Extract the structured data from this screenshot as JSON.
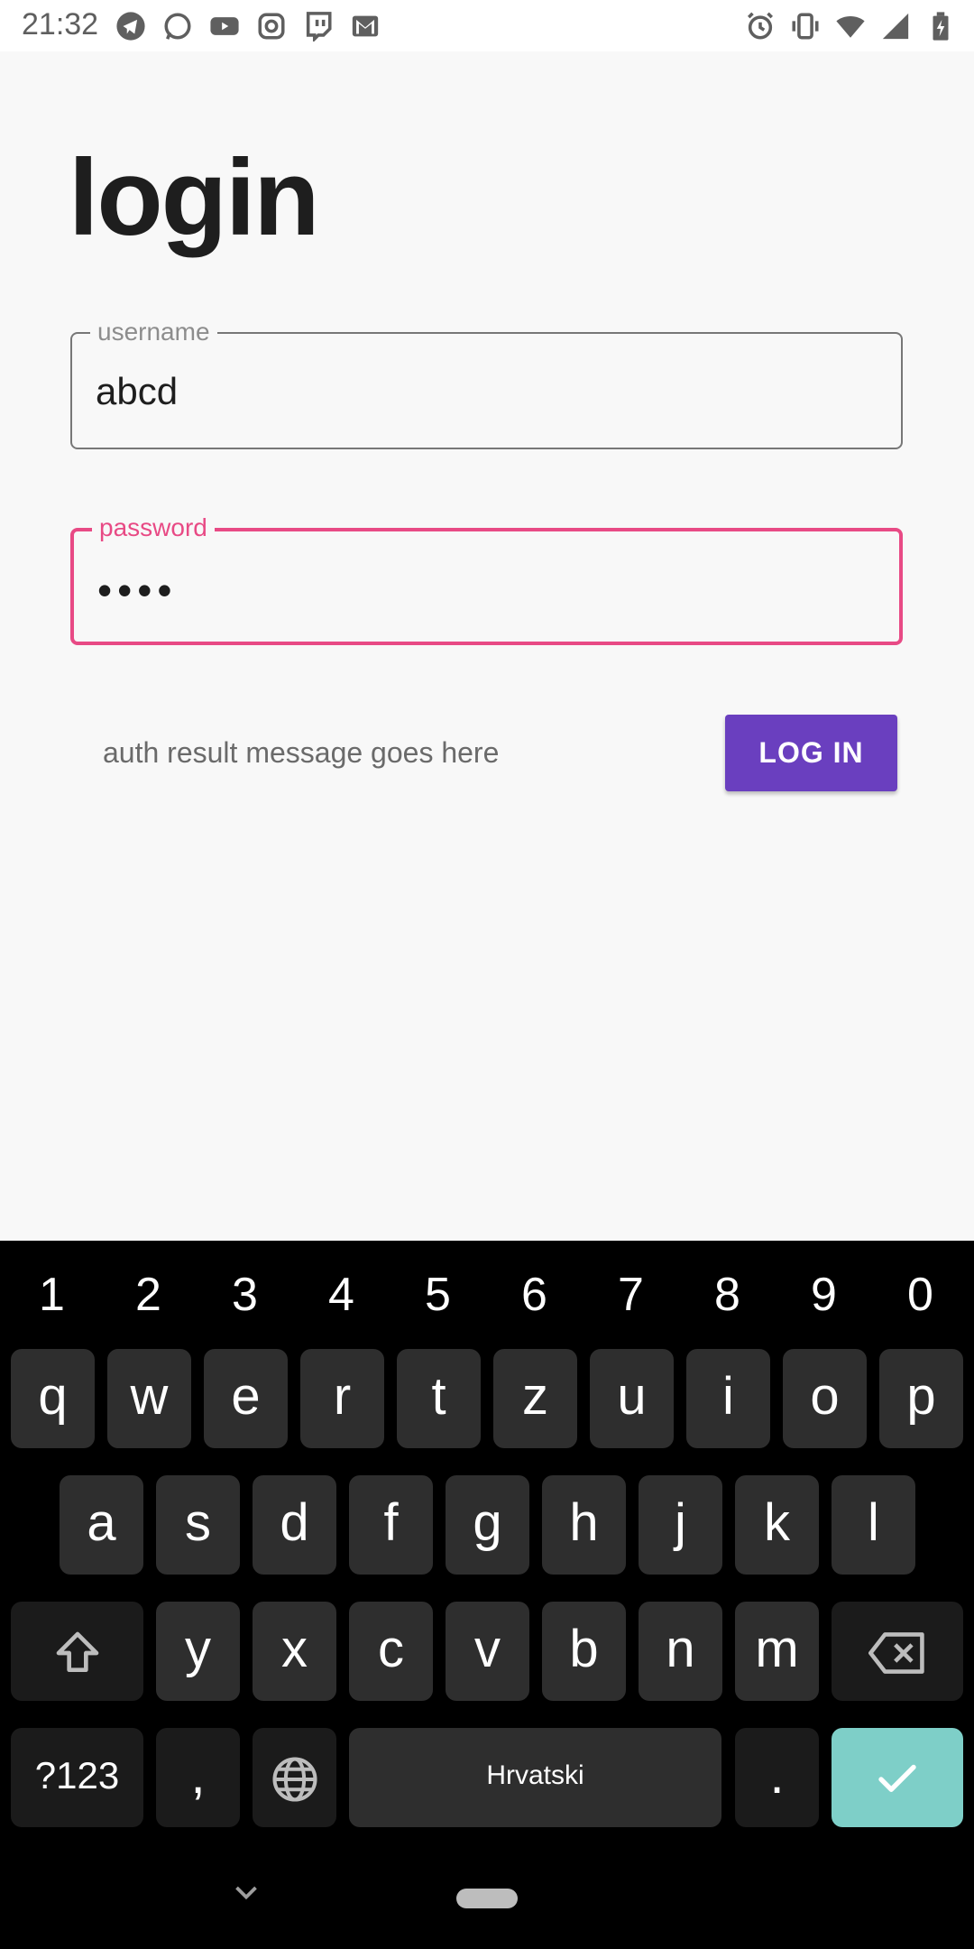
{
  "status_bar": {
    "time": "21:32",
    "notification_icons": [
      "telegram-icon",
      "whatsapp-icon",
      "youtube-icon",
      "instagram-icon",
      "twitch-icon",
      "gmail-icon"
    ],
    "system_icons": [
      "alarm-icon",
      "vibrate-icon",
      "wifi-icon",
      "signal-icon",
      "battery-icon"
    ]
  },
  "login": {
    "title": "login",
    "username": {
      "label": "username",
      "value": "abcd"
    },
    "password": {
      "label": "password",
      "value": "••••",
      "focused": true
    },
    "auth_message": "auth result message goes here",
    "button_label": "LOG IN"
  },
  "keyboard": {
    "number_row": [
      "1",
      "2",
      "3",
      "4",
      "5",
      "6",
      "7",
      "8",
      "9",
      "0"
    ],
    "row1": [
      "q",
      "w",
      "e",
      "r",
      "t",
      "z",
      "u",
      "i",
      "o",
      "p"
    ],
    "row2": [
      "a",
      "s",
      "d",
      "f",
      "g",
      "h",
      "j",
      "k",
      "l"
    ],
    "row3": [
      "y",
      "x",
      "c",
      "v",
      "b",
      "n",
      "m"
    ],
    "symbols_label": "?123",
    "comma": ",",
    "space_label": "Hrvatski",
    "period": "."
  },
  "colors": {
    "accent": "#6a3fbf",
    "focus": "#e84a85",
    "enter_key": "#7ecfc8"
  }
}
